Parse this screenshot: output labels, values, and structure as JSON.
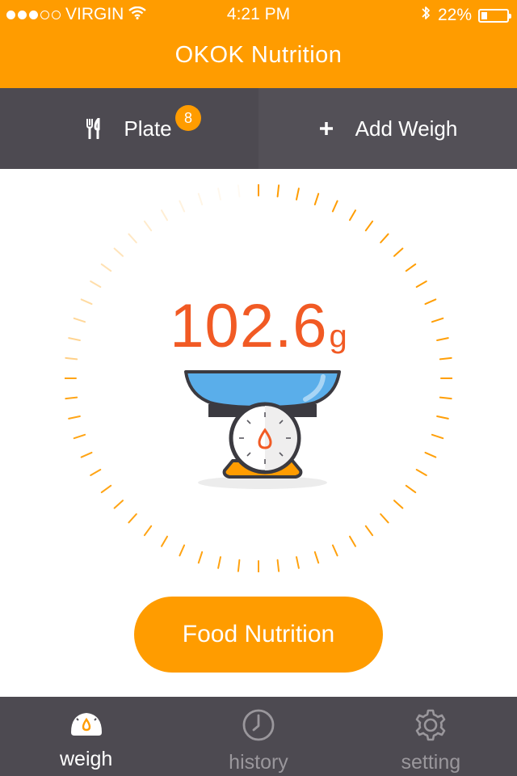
{
  "status_bar": {
    "carrier": "VIRGIN",
    "signal_bars_filled": 3,
    "signal_bars_total": 5,
    "time": "4:21 PM",
    "battery": "22%",
    "battery_level": 0.22,
    "icons": [
      "wifi-icon",
      "bluetooth-icon",
      "battery-icon"
    ]
  },
  "header": {
    "title": "OKOK Nutrition"
  },
  "tabs": {
    "plate": {
      "label": "Plate",
      "badge": "8",
      "icon": "fork-knife-icon"
    },
    "add": {
      "label": "Add Weigh",
      "icon": "plus-icon"
    }
  },
  "weight": {
    "value": "102.6",
    "unit": "g"
  },
  "dial": {
    "highlighted_fraction": 0.75
  },
  "cta": {
    "label": "Food Nutrition"
  },
  "tabbar": {
    "items": [
      {
        "label": "weigh",
        "icon": "scale-icon",
        "active": true
      },
      {
        "label": "history",
        "icon": "clock-icon",
        "active": false
      },
      {
        "label": "setting",
        "icon": "gear-icon",
        "active": false
      }
    ]
  },
  "colors": {
    "accent": "#ff9c00",
    "weight_text": "#f15a24",
    "dark_bar": "#4d4a51",
    "bowl_blue": "#5aaeea"
  }
}
